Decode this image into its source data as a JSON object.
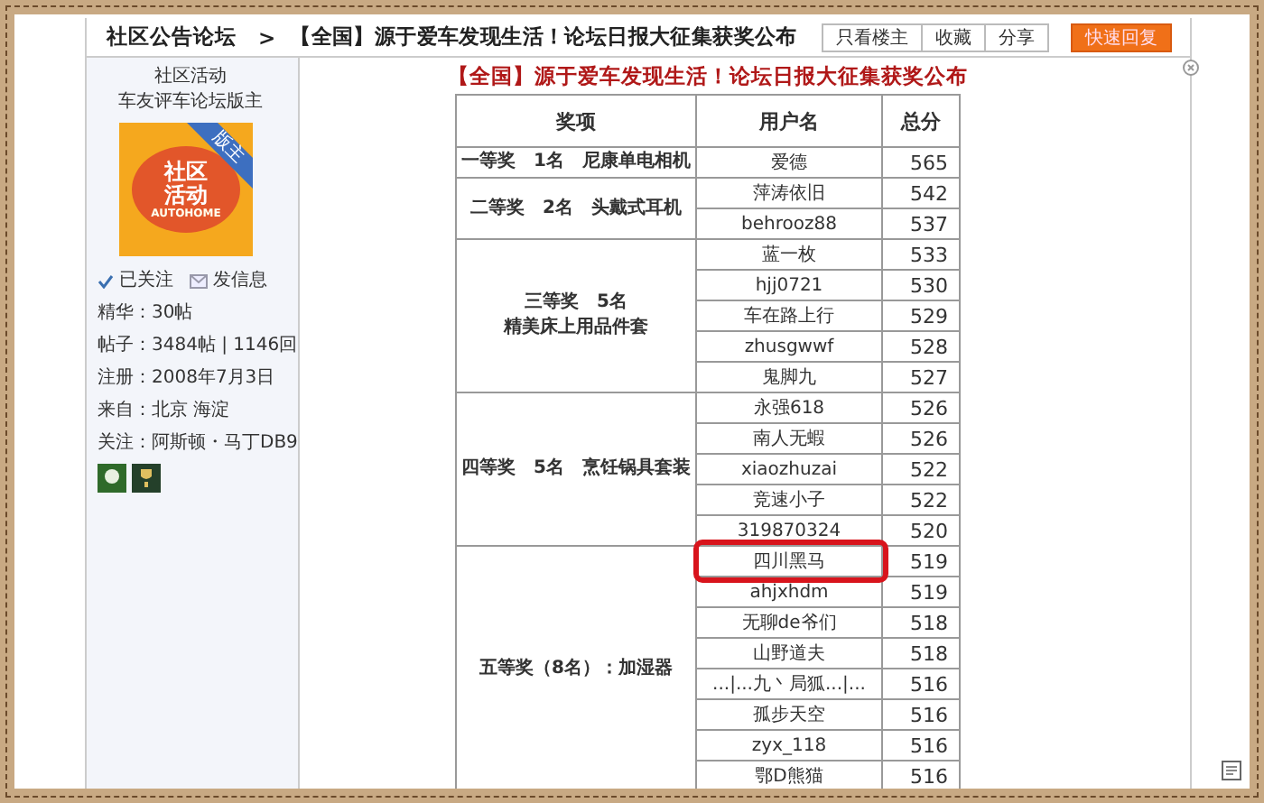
{
  "breadcrumb": {
    "forum": "社区公告论坛",
    "separator": ">",
    "title": "【全国】源于爱车发现生活！论坛日报大征集获奖公布"
  },
  "actions": [
    {
      "label": "只看楼主",
      "kind": "plain"
    },
    {
      "label": "收藏",
      "kind": "plain"
    },
    {
      "label": "分享",
      "kind": "plain"
    },
    {
      "label": "快速回复",
      "kind": "primary"
    }
  ],
  "author": {
    "name": "社区活动",
    "role": "车友评车论坛版主",
    "logo_title": "社区活动",
    "logo_sub": "AUTOHOME",
    "badge": "版主",
    "follow": "已关注",
    "message": "发信息",
    "stats": [
      "精华：30帖",
      "帖子：3484帖 | 1146回",
      "注册：2008年7月3日",
      "来自：北京 海淀",
      "关注：阿斯顿・马丁DB9"
    ]
  },
  "post": {
    "title": "【全国】源于爱车发现生活！论坛日报大征集获奖公布",
    "table": {
      "columns": [
        "奖项",
        "用户名",
        "总分"
      ],
      "groups": [
        {
          "prize": [
            "一等奖　1名　尼康单电相机"
          ],
          "winners": [
            {
              "user": "爱德",
              "score": "565",
              "circled": false
            }
          ]
        },
        {
          "prize": [
            "二等奖　2名　头戴式耳机"
          ],
          "winners": [
            {
              "user": "萍涛依旧",
              "score": "542",
              "circled": false
            },
            {
              "user": "behrooz88",
              "score": "537",
              "circled": false
            }
          ]
        },
        {
          "prize": [
            "三等奖　5名",
            "精美床上用品件套"
          ],
          "winners": [
            {
              "user": "蓝一枚",
              "score": "533",
              "circled": false
            },
            {
              "user": "hjj0721",
              "score": "530",
              "circled": false
            },
            {
              "user": "车在路上行",
              "score": "529",
              "circled": false
            },
            {
              "user": "zhusgwwf",
              "score": "528",
              "circled": false
            },
            {
              "user": "鬼脚九",
              "score": "527",
              "circled": false
            }
          ]
        },
        {
          "prize": [
            "四等奖　5名　烹饪锅具套装"
          ],
          "winners": [
            {
              "user": "永强618",
              "score": "526",
              "circled": false
            },
            {
              "user": "南人无蝦",
              "score": "526",
              "circled": false
            },
            {
              "user": "xiaozhuzai",
              "score": "522",
              "circled": false
            },
            {
              "user": "竞速小子",
              "score": "522",
              "circled": false
            },
            {
              "user": "319870324",
              "score": "520",
              "circled": false
            }
          ]
        },
        {
          "prize": [
            "五等奖（8名）：加湿器"
          ],
          "winners": [
            {
              "user": "四川黑马",
              "score": "519",
              "circled": true
            },
            {
              "user": "ahjxhdm",
              "score": "519",
              "circled": false
            },
            {
              "user": "无聊de爷们",
              "score": "518",
              "circled": false
            },
            {
              "user": "山野道夫",
              "score": "518",
              "circled": false
            },
            {
              "user": "...|...九丶局狐...|...",
              "score": "516",
              "circled": false
            },
            {
              "user": "孤步天空",
              "score": "516",
              "circled": false
            },
            {
              "user": "zyx_118",
              "score": "516",
              "circled": false
            },
            {
              "user": "鄂D熊猫",
              "score": "516",
              "circled": false
            }
          ]
        }
      ]
    }
  }
}
